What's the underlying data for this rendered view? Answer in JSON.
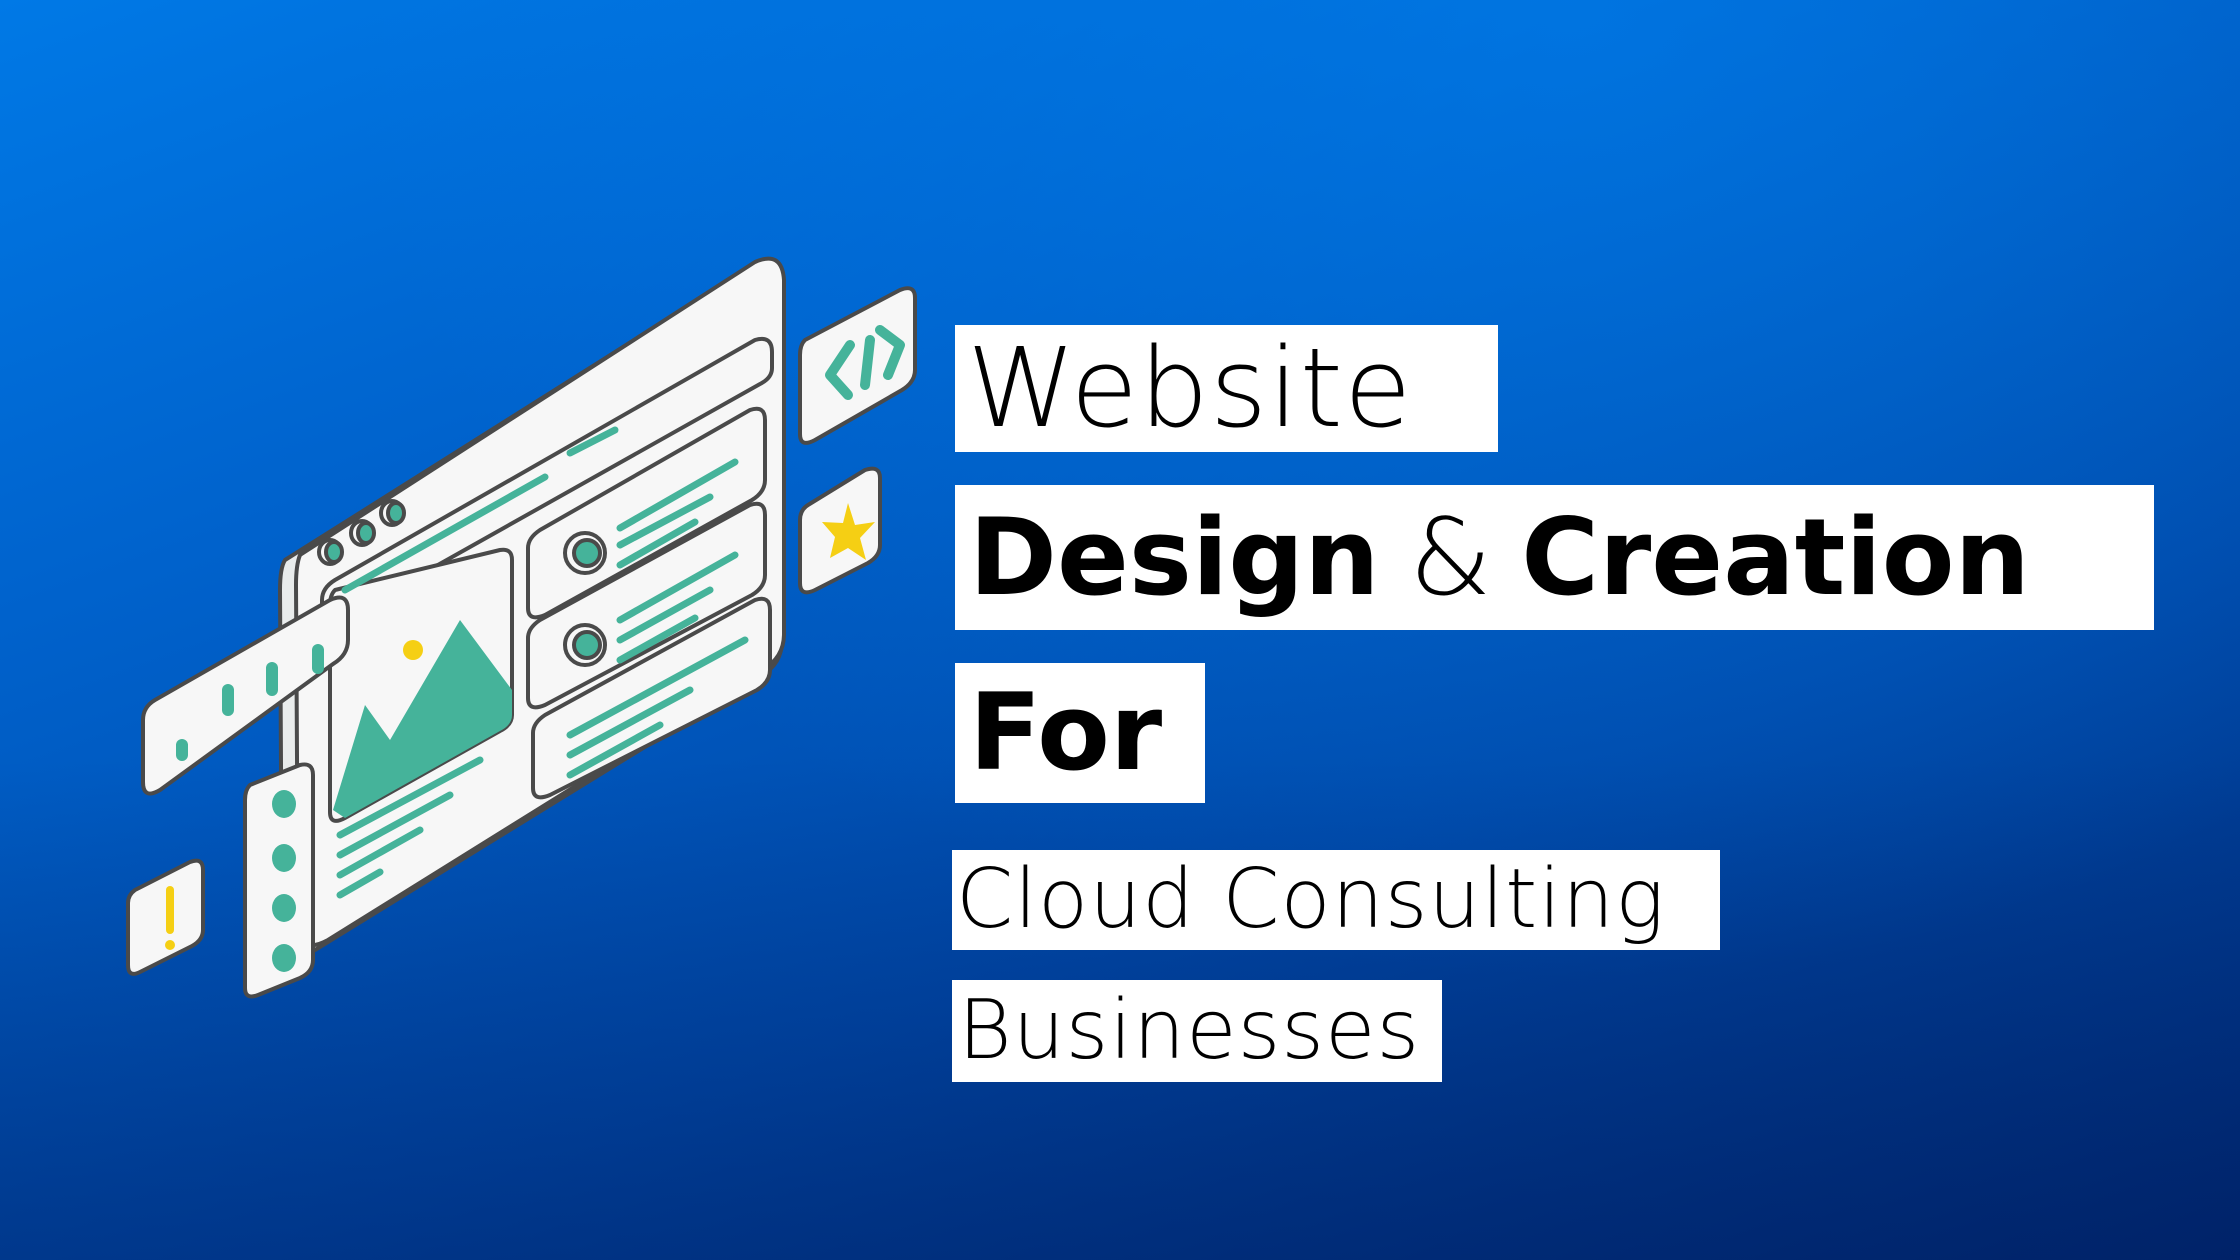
{
  "banner": {
    "line1": "Website",
    "line2_part1": "Design",
    "line2_amp": "&",
    "line2_part2": "Creation",
    "line3": "For",
    "line4": "Cloud Consulting",
    "line5": "Businesses"
  },
  "illustration": {
    "subject": "isometric website layout",
    "icons": [
      "code-icon",
      "star-icon",
      "alert-icon",
      "image-icon",
      "bar-chart-icon",
      "window-dots-icon"
    ]
  },
  "colors": {
    "bg_top": "#0079e6",
    "bg_bottom": "#002a75",
    "panel": "#f7f7f7",
    "outline": "#4a4a4a",
    "accent_green": "#45b39a",
    "accent_yellow": "#f5cf14",
    "label_bg": "#ffffff",
    "text": "#000000"
  }
}
